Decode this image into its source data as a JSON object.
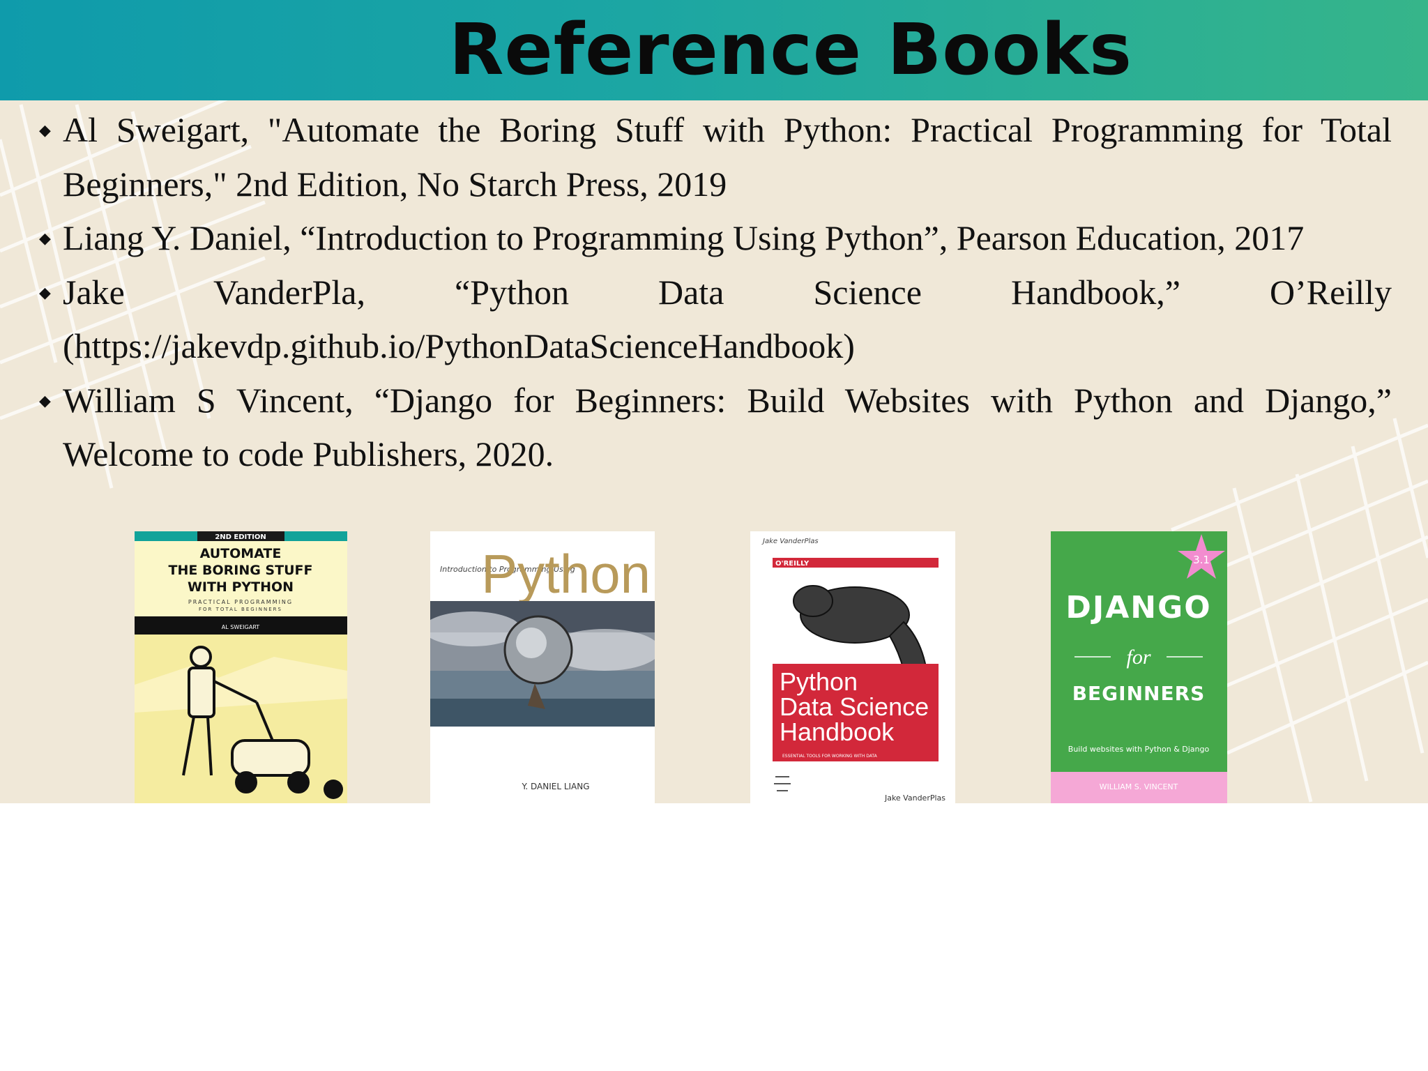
{
  "title": "Reference Books",
  "references": [
    {
      "text": "Al Sweigart, \"Automate the Boring Stuff with Python: Practical Programming for Total Beginners,\" 2nd Edition, No Starch Press, 2019"
    },
    {
      "text": "Liang Y. Daniel, “Introduction to Programming Using Python”, Pearson Education, 2017"
    },
    {
      "text": "Jake VanderPla, “Python Data Science Handbook,” O’Reilly (https://jakevdp.github.io/PythonDataScienceHandbook)"
    },
    {
      "text": "William S Vincent, “Django for Beginners: Build Websites with Python and Django,” Welcome to code Publishers, 2020."
    }
  ],
  "bullet_glyph": "◆",
  "covers": {
    "automate": {
      "edition": "2ND EDITION",
      "title_line1": "AUTOMATE",
      "title_line2": "THE BORING STUFF",
      "title_line3": "WITH PYTHON",
      "subtitle_line1": "PRACTICAL PROGRAMMING",
      "subtitle_line2": "FOR TOTAL BEGINNERS",
      "author": "AL SWEIGART"
    },
    "liang": {
      "intro": "Introduction to Programming Using",
      "python_word": "Python",
      "author": "Y. DANIEL LIANG"
    },
    "vanderplas": {
      "author_top": "Jake VanderPlas",
      "publisher": "O'REILLY",
      "title_line1": "Python",
      "title_line2": "Data Science",
      "title_line3": "Handbook",
      "tagline": "ESSENTIAL TOOLS FOR WORKING WITH DATA",
      "author_bottom": "Jake VanderPlas"
    },
    "django": {
      "version": "3.1",
      "title_line1": "DJANGO",
      "title_line2": "for",
      "title_line3": "BEGINNERS",
      "tagline": "Build websites with Python & Django",
      "author": "WILLIAM S. VINCENT"
    }
  },
  "colors": {
    "header_start": "#0f9bab",
    "header_end": "#36b58a",
    "slide_bg": "#f0e8d8",
    "grid_lines": "#ffffff"
  }
}
